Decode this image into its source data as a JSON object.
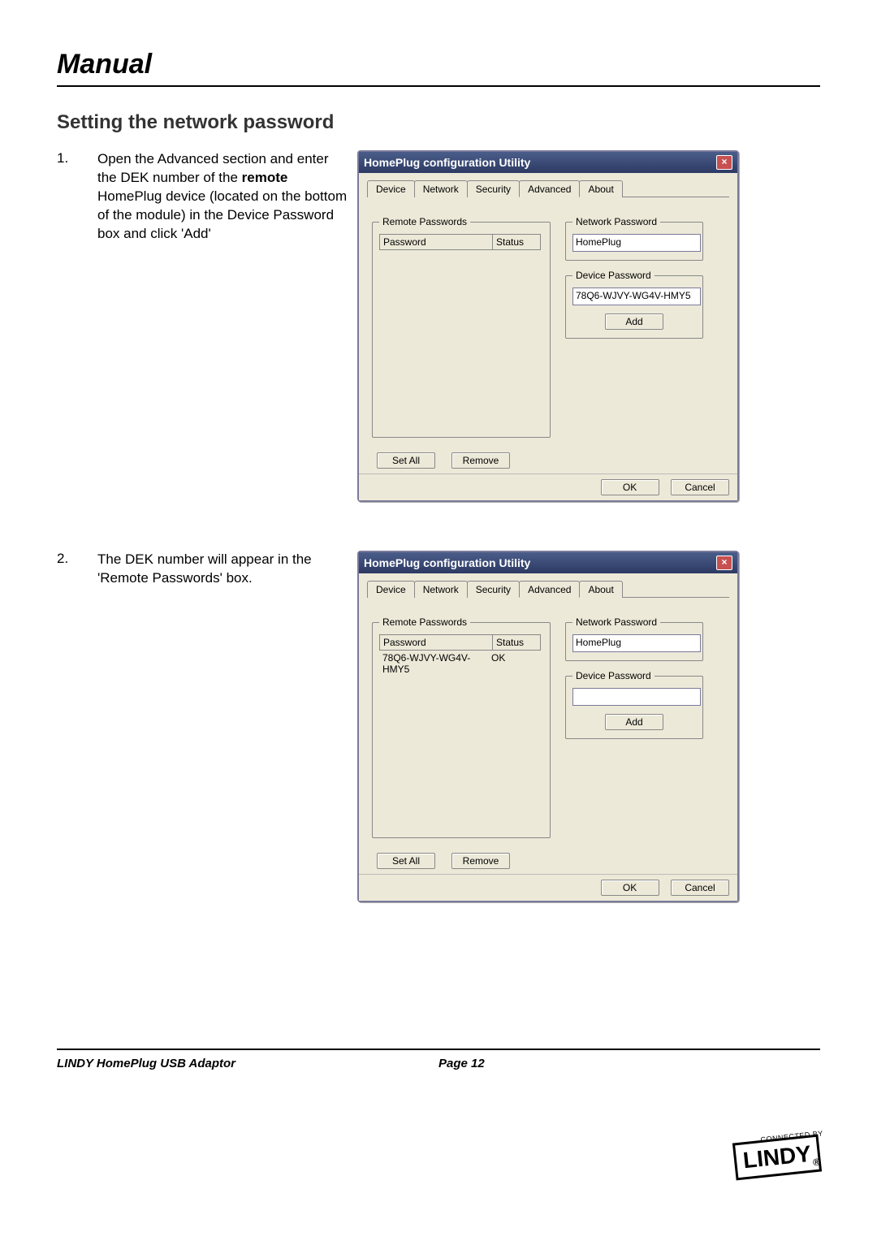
{
  "header": {
    "title": "Manual"
  },
  "section": {
    "title": "Setting the network password"
  },
  "steps": [
    {
      "num": "1.",
      "text_pre": "Open the Advanced section and enter the DEK number of the ",
      "text_bold": "remote",
      "text_post": " HomePlug device (located on the bottom of the module) in the Device Password box and click 'Add'"
    },
    {
      "num": "2.",
      "text_pre": "The DEK number will appear in the 'Remote Passwords' box.",
      "text_bold": "",
      "text_post": ""
    }
  ],
  "dialog": {
    "title": "HomePlug configuration Utility",
    "close": "×",
    "tabs": [
      "Device",
      "Network",
      "Security",
      "Advanced",
      "About"
    ],
    "active_tab": "Advanced",
    "remote_group": "Remote Passwords",
    "col_password": "Password",
    "col_status": "Status",
    "network_group": "Network Password",
    "network_value": "HomePlug",
    "device_group": "Device Password",
    "add": "Add",
    "set_all": "Set All",
    "remove": "Remove",
    "ok": "OK",
    "cancel": "Cancel"
  },
  "shot1": {
    "device_value": "78Q6-WJVY-WG4V-HMY5",
    "rows": []
  },
  "shot2": {
    "device_value": "",
    "rows": [
      {
        "password": "78Q6-WJVY-WG4V-HMY5",
        "status": "OK"
      }
    ]
  },
  "footer": {
    "product": "LINDY HomePlug USB Adaptor",
    "page": "Page 12",
    "connected_by": "CONNECTED BY",
    "brand": "LINDY"
  }
}
